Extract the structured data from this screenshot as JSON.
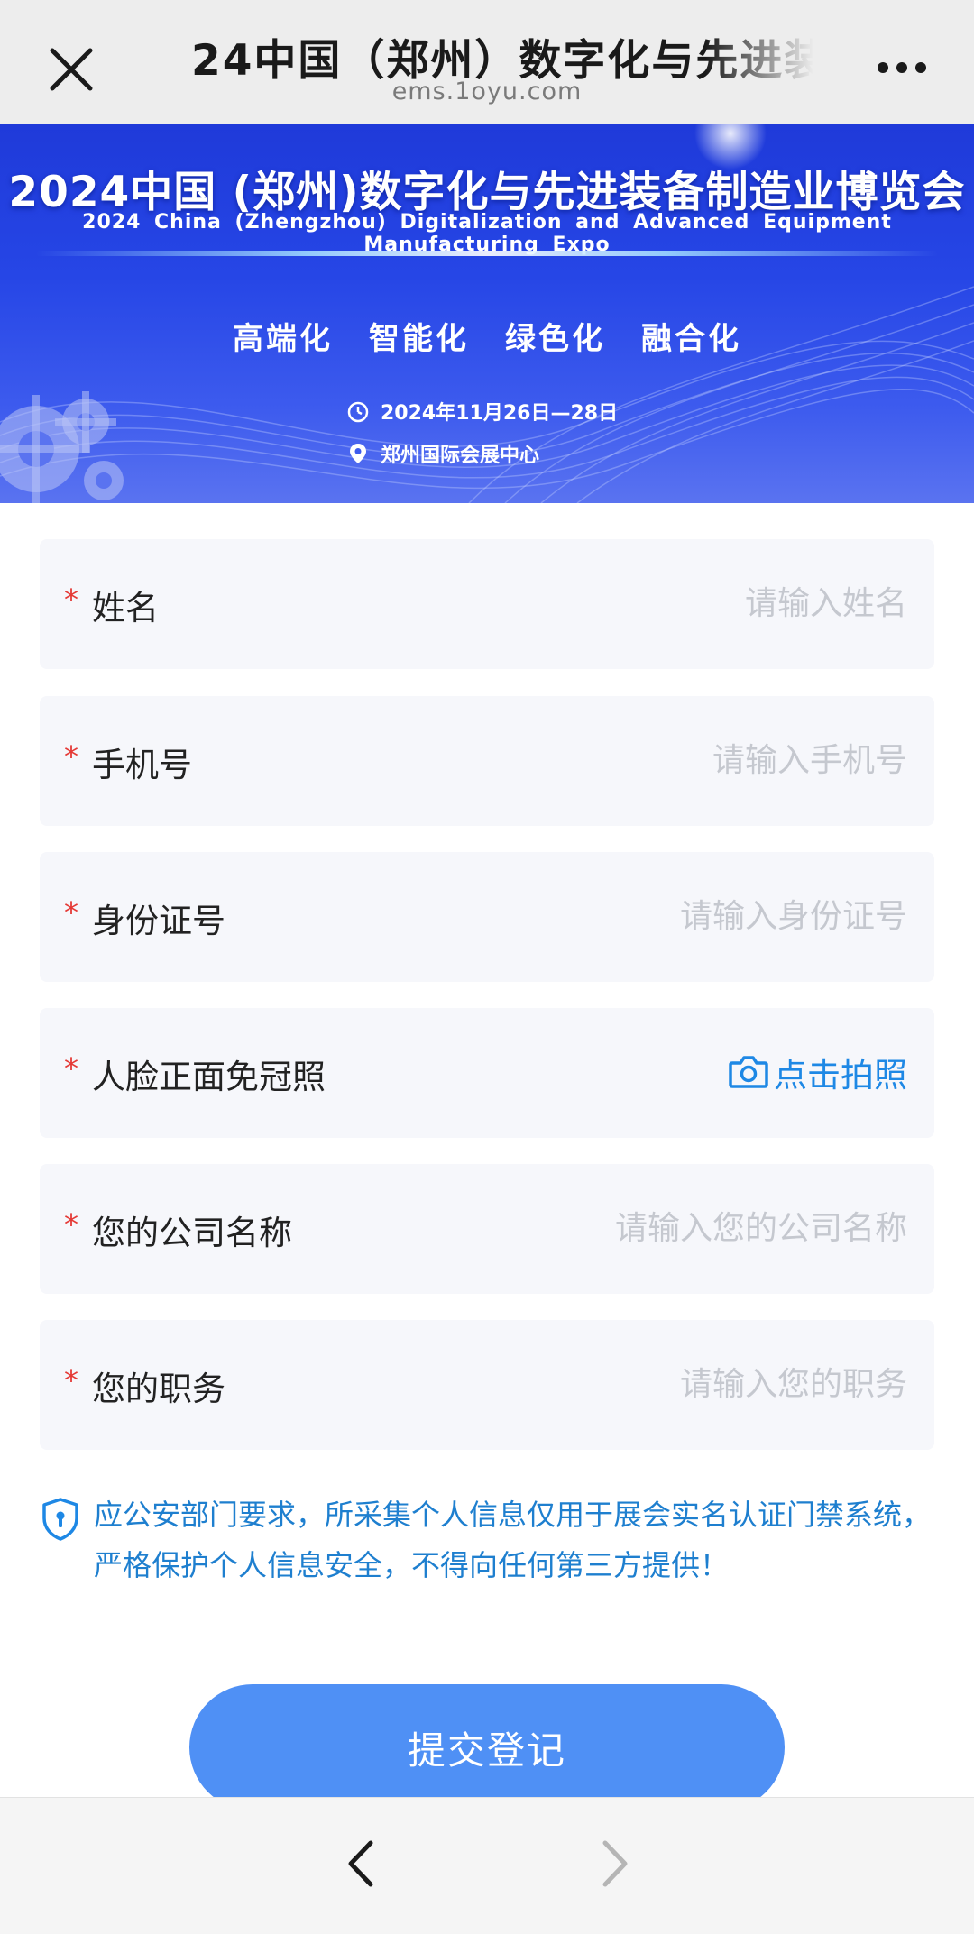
{
  "browser": {
    "title": "24中国（郑州）数字化与先进装",
    "domain": "ems.1oyu.com"
  },
  "banner": {
    "title": "2024中国 (郑州)数字化与先进装备制造业博览会",
    "subtitle": "2024 China (Zhengzhou) Digitalization and Advanced Equipment Manufacturing Expo",
    "slogans": [
      "高端化",
      "智能化",
      "绿色化",
      "融合化"
    ],
    "date": "2024年11月26日—28日",
    "venue": "郑州国际会展中心"
  },
  "form": {
    "required_mark": "*",
    "fields": [
      {
        "label": "姓名",
        "placeholder": "请输入姓名"
      },
      {
        "label": "手机号",
        "placeholder": "请输入手机号"
      },
      {
        "label": "身份证号",
        "placeholder": "请输入身份证号"
      },
      {
        "label": "人脸正面免冠照",
        "action": "点击拍照"
      },
      {
        "label": "您的公司名称",
        "placeholder": "请输入您的公司名称"
      },
      {
        "label": "您的职务",
        "placeholder": "请输入您的职务"
      }
    ],
    "notice": "应公安部门要求，所采集个人信息仅用于展会实名认证门禁系统，严格保护个人信息安全，不得向任何第三方提供！",
    "submit_label": "提交登记"
  },
  "colors": {
    "required": "#e53935",
    "accent": "#1e88e5",
    "notice_text": "#1e7fcf",
    "submit_bg": "#4f90f5",
    "banner_blue": "#2646e6"
  },
  "icons": {
    "close": "close-icon",
    "more": "more-icon",
    "clock": "clock-icon",
    "location": "location-pin-icon",
    "camera": "camera-icon",
    "shield": "shield-icon",
    "back": "chevron-left-icon",
    "forward": "chevron-right-icon"
  }
}
